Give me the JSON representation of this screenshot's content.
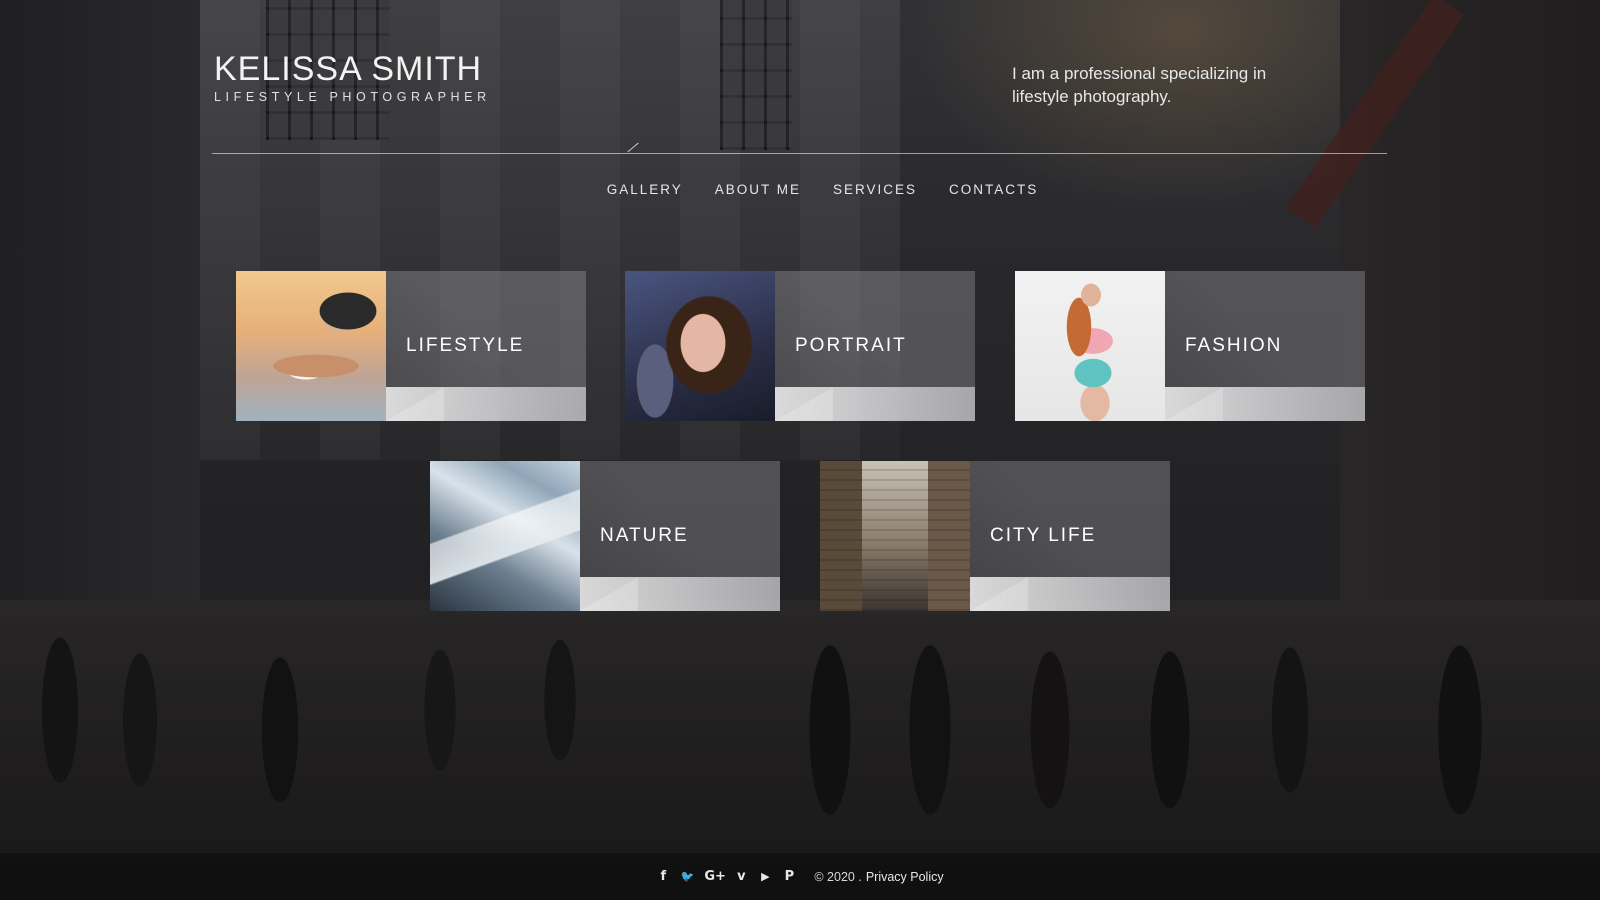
{
  "brand": {
    "name": "KELISSA SMITH",
    "subtitle": "LIFESTYLE PHOTOGRAPHER"
  },
  "tagline": "I am a professional specializing in lifestyle photography.",
  "nav": {
    "items": [
      {
        "label": "GALLERY"
      },
      {
        "label": "ABOUT ME"
      },
      {
        "label": "SERVICES"
      },
      {
        "label": "CONTACTS"
      }
    ]
  },
  "gallery": {
    "tiles": [
      {
        "label": "LIFESTYLE"
      },
      {
        "label": "PORTRAIT"
      },
      {
        "label": "FASHION"
      },
      {
        "label": "NATURE"
      },
      {
        "label": "CITY LIFE"
      }
    ]
  },
  "footer": {
    "social": [
      {
        "icon": "facebook-icon",
        "glyph": "f"
      },
      {
        "icon": "twitter-icon",
        "glyph": "🐦"
      },
      {
        "icon": "google-plus-icon",
        "glyph": "G+"
      },
      {
        "icon": "vimeo-icon",
        "glyph": "v"
      },
      {
        "icon": "youtube-icon",
        "glyph": "▶"
      },
      {
        "icon": "pinterest-icon",
        "glyph": "P"
      }
    ],
    "copyright": "© 2020 .",
    "privacy_link": "Privacy Policy"
  }
}
